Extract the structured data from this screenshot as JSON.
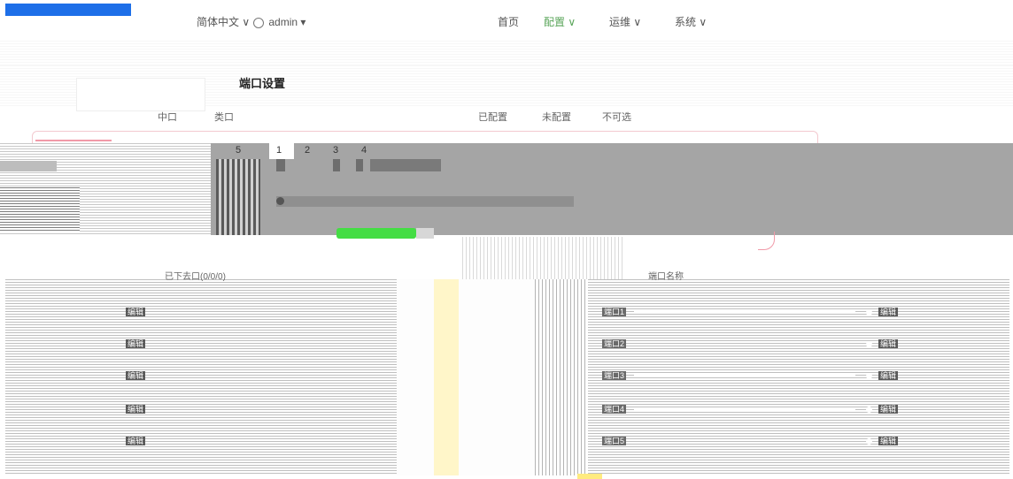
{
  "topbar": {
    "language": "简体中文 ∨",
    "user": "admin ▾",
    "nav": {
      "home": "首页",
      "config": "配置 ∨",
      "ops": "运维 ∨",
      "system": "系统 ∨"
    }
  },
  "page": {
    "title": "端口设置"
  },
  "filters": {
    "a": "中口",
    "b": "类口",
    "c": "已配置",
    "d": "未配置",
    "e": "不可选"
  },
  "panel": {
    "tabs": [
      "5",
      "1",
      "2",
      "3",
      "4"
    ]
  },
  "list": {
    "left_header": "已下去口(0/0/0)",
    "right_header": "端口名称",
    "action_label": "编辑",
    "rows": [
      {
        "name": "端口1",
        "action": "编辑"
      },
      {
        "name": "端口2",
        "action": "编辑"
      },
      {
        "name": "端口3",
        "action": "编辑"
      },
      {
        "name": "端口4",
        "action": "编辑"
      },
      {
        "name": "端口5",
        "action": "编辑"
      }
    ]
  },
  "colors": {
    "brand": "#1e6fe8",
    "progress": "#44dd44",
    "accent_pink": "#f19aa8"
  }
}
